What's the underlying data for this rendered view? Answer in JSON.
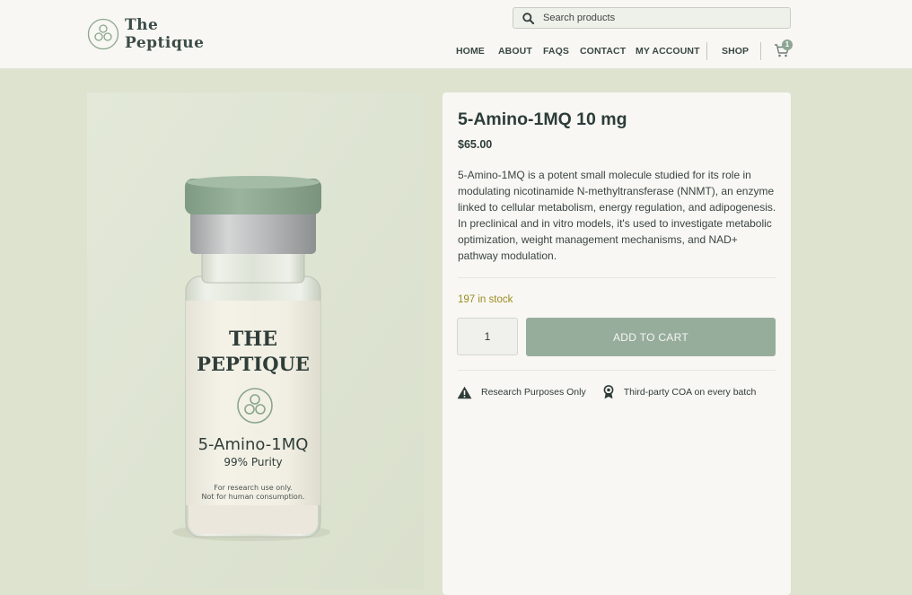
{
  "brand": {
    "line1": "The",
    "line2": "Peptique"
  },
  "search": {
    "placeholder": "Search products"
  },
  "nav": {
    "items": [
      "HOME",
      "ABOUT",
      "FAQS",
      "CONTACT",
      "MY ACCOUNT",
      "SHOP"
    ],
    "cart_count": "1"
  },
  "product_image": {
    "brand_line1": "THE",
    "brand_line2": "PEPTIQUE",
    "name": "5-Amino-1MQ",
    "purity": "99% Purity",
    "disclaimer_line1": "For research use only.",
    "disclaimer_line2": "Not for human consumption."
  },
  "product": {
    "title": "5-Amino-1MQ 10 mg",
    "price": "$65.00",
    "description": "5-Amino-1MQ is a potent small molecule studied for its role in modulating nicotinamide N-methyltransferase (NNMT), an enzyme linked to cellular metabolism, energy regulation, and adipogenesis. In preclinical and in vitro models, it's used to investigate metabolic optimization, weight management mechanisms, and NAD+ pathway modulation.",
    "stock": "197 in stock",
    "quantity": "1",
    "add_to_cart": "ADD TO CART",
    "badges": [
      "Research Purposes Only",
      "Third-party COA on every batch"
    ]
  },
  "colors": {
    "page_bg": "#dde3cf",
    "header_bg": "#f8f7f3",
    "button": "#97ad9c",
    "stock_text": "#9b8d22",
    "cap": "#8aa58d"
  }
}
